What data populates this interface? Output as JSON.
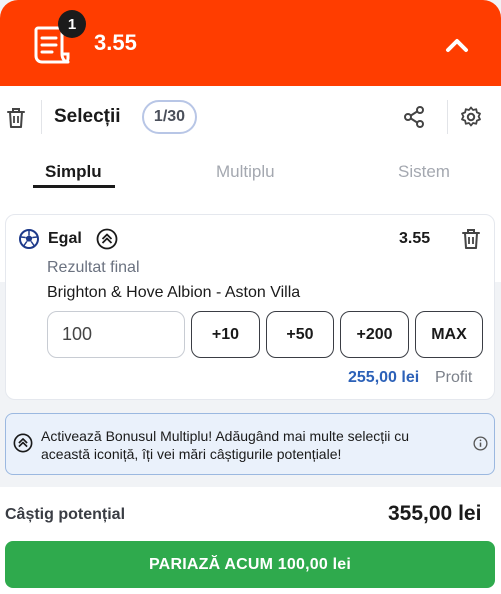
{
  "header": {
    "badge_count": "1",
    "total_odds": "3.55"
  },
  "toolbar": {
    "title": "Selecții",
    "selection_count": "1/30"
  },
  "tabs": [
    {
      "label": "Simplu",
      "active": true
    },
    {
      "label": "Multiplu",
      "active": false
    },
    {
      "label": "Sistem",
      "active": false
    }
  ],
  "bet": {
    "selection": "Egal",
    "odds": "3.55",
    "market": "Rezultat final",
    "event": "Brighton & Hove Albion - Aston Villa",
    "stake": "100",
    "quick_stakes": [
      "+10",
      "+50",
      "+200",
      "MAX"
    ],
    "profit_value": "255,00 lei",
    "profit_label": "Profit"
  },
  "banner": {
    "text": "Activează Bonusul Multiplu! Adăugând mai multe selecții cu această iconiță, îți vei mări câștigurile potențiale!"
  },
  "footer": {
    "potential_win_label": "Câștig potențial",
    "potential_win_value": "355,00 lei",
    "place_bet_label": "PARIAZĂ ACUM 100,00 lei"
  },
  "colors": {
    "header": "#ff3d00",
    "accent_blue": "#2c61b8",
    "place_button": "#2faa4d"
  }
}
